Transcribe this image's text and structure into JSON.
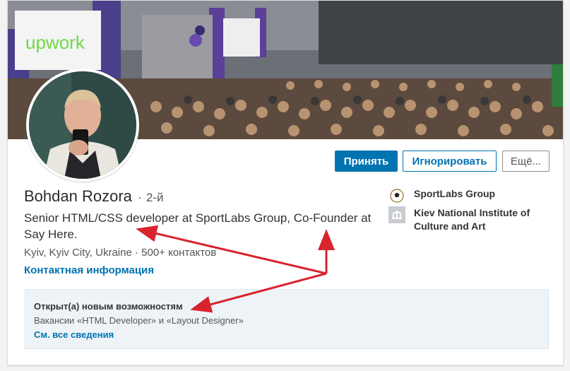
{
  "banner": {
    "upwork_logo": "upwork"
  },
  "actions": {
    "accept_label": "Принять",
    "ignore_label": "Игнорировать",
    "more_label": "Ещё..."
  },
  "profile": {
    "name": "Bohdan Rozora",
    "separator": "·",
    "degree": "2-й",
    "headline": "Senior HTML/CSS developer at SportLabs Group, Co-Founder at Say Here.",
    "location": "Kyiv, Kyiv City, Ukraine  ·  500+ контактов",
    "contact_link": "Контактная информация"
  },
  "side": {
    "company": {
      "label": "SportLabs Group",
      "icon": "soccer-ball-icon"
    },
    "school": {
      "label": "Kiev National Institute of Culture and Art",
      "icon": "school-icon"
    }
  },
  "open_to": {
    "title": "Открыт(а) новым возможностям",
    "description": "Вакансии «HTML Developer» и «Layout Designer»",
    "link": "См. все сведения"
  },
  "colors": {
    "primary": "#0073b1",
    "annotation_arrow": "#d9232d",
    "open_box_bg": "#eef3f8"
  }
}
